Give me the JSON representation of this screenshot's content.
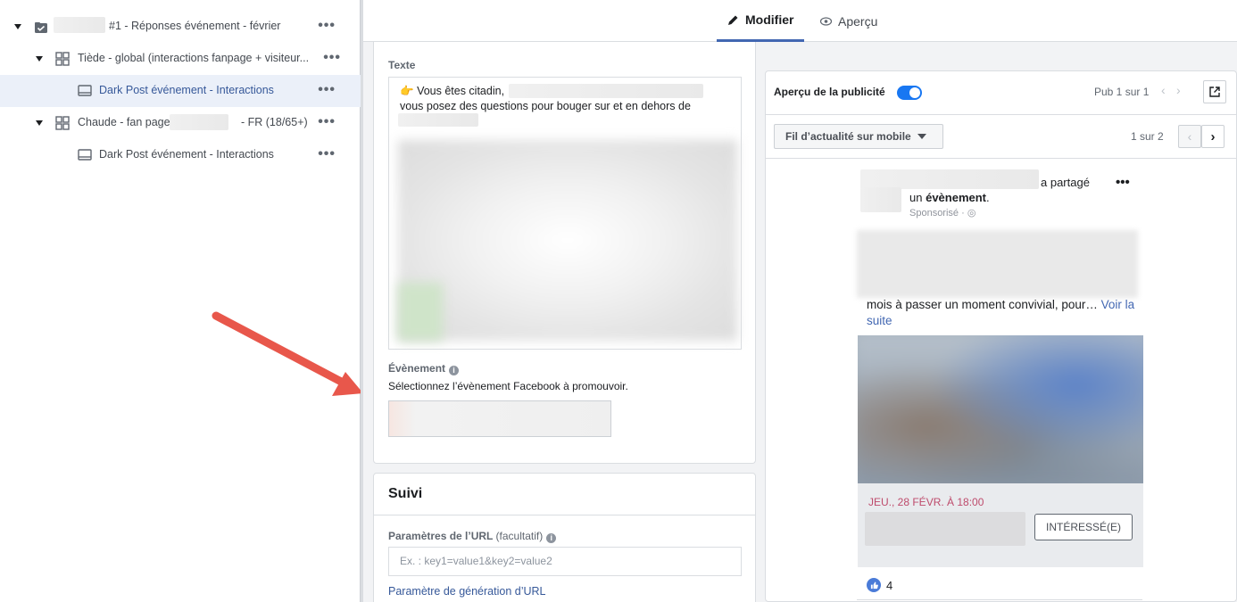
{
  "tree": {
    "items": [
      {
        "label": "#1 - Réponses événement - février",
        "type": "campaign"
      },
      {
        "label": "Tiède - global (interactions fanpage + visiteur...",
        "type": "adset"
      },
      {
        "label": "Dark Post événement - Interactions",
        "type": "ad",
        "selected": true
      },
      {
        "label_prefix": "Chaude - fan page",
        "label_suffix": "- FR (18/65+)",
        "type": "adset"
      },
      {
        "label": "Dark Post événement - Interactions",
        "type": "ad"
      }
    ],
    "more_label": "•••"
  },
  "tabs": [
    {
      "label": "Modifier",
      "icon": "pencil-icon",
      "active": true
    },
    {
      "label": "Aperçu",
      "icon": "eye-icon",
      "active": false
    }
  ],
  "editor": {
    "text_label": "Texte",
    "text_line1": "Vous êtes citadin,",
    "text_line2": "vous posez des questions pour bouger sur et en dehors de",
    "event_label": "Évènement",
    "event_help": "Sélectionnez l’évènement Facebook à promouvoir.",
    "tracking_title": "Suivi",
    "url_params_label": "Paramètres de l’URL",
    "url_params_optional": "(facultatif)",
    "url_placeholder": "Ex. : key1=value1&key2=value2",
    "url_builder_link": "Paramètre de génération d’URL"
  },
  "preview": {
    "title": "Aperçu de la publicité",
    "pub_counter": "Pub 1 sur 1",
    "placement": "Fil d’actualité sur mobile",
    "page_counter": "1 sur 2",
    "post": {
      "shared_text": "a partagé",
      "shared_text2": "un",
      "shared_bold": "évènement",
      "sponsored": "Sponsorisé",
      "body": "mois à passer un moment convivial, pour…",
      "see_more": "Voir la suite",
      "event_date": "JEU., 28 FÉVR. À 18:00",
      "interested_btn": "INTÉRESSÉ(E)",
      "likes": "4"
    }
  },
  "colors": {
    "accent": "#4267b2",
    "link": "#365899",
    "event_date": "#be4b6c",
    "arrow": "#e8574b"
  }
}
